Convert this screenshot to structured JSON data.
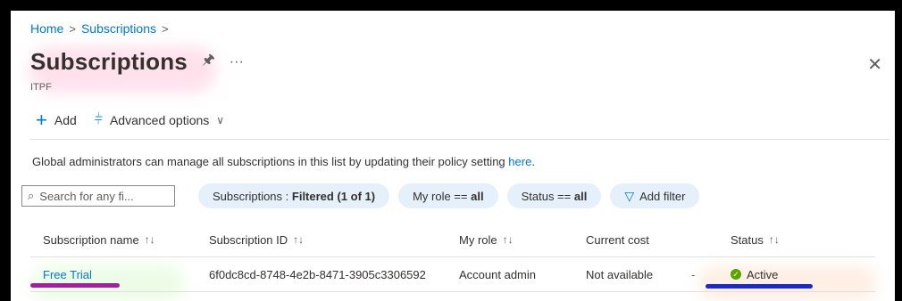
{
  "breadcrumb": {
    "home": "Home",
    "current": "Subscriptions"
  },
  "header": {
    "title": "Subscriptions",
    "subtitle": "ITPF"
  },
  "toolbar": {
    "add_label": "Add",
    "advanced_label": "Advanced options"
  },
  "notice": {
    "text": "Global administrators can manage all subscriptions in this list by updating their policy setting",
    "link": "here",
    "end": "."
  },
  "filters": {
    "search_placeholder": "Search for any fi...",
    "subscriptions_prefix": "Subscriptions : ",
    "subscriptions_value": "Filtered (1 of 1)",
    "role_prefix": "My role == ",
    "role_value": "all",
    "status_prefix": "Status == ",
    "status_value": "all",
    "add_filter": "Add filter"
  },
  "table": {
    "columns": [
      "Subscription name",
      "Subscription ID",
      "My role",
      "Current cost",
      "Status"
    ],
    "rows": [
      {
        "name": "Free Trial",
        "id": "6f0dc8cd-8748-4e2b-8471-3905c3306592",
        "role": "Account admin",
        "cost": "Not available",
        "dash": "-",
        "status": "Active"
      }
    ]
  },
  "colors": {
    "accent": "#0078d4",
    "status_active": "#57a300",
    "pill_bg": "#e6f0fa"
  }
}
